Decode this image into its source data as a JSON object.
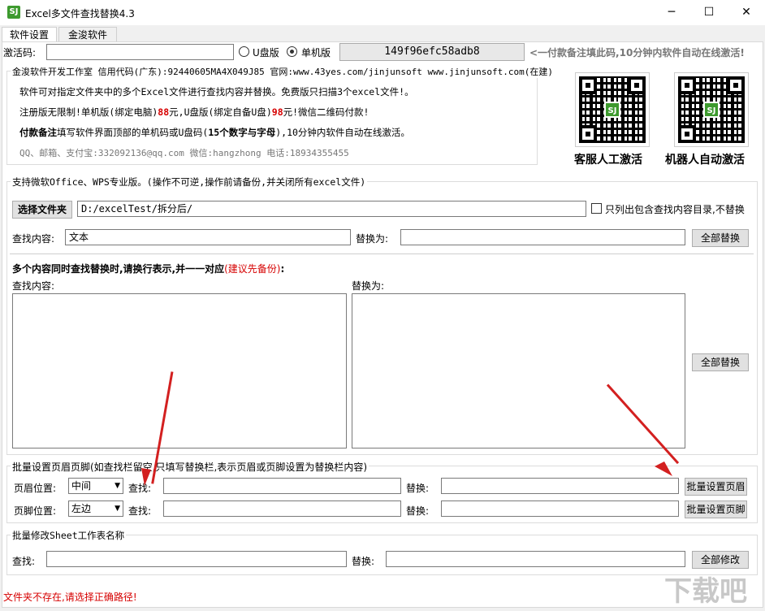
{
  "window": {
    "title": "Excel多文件查找替换4.3",
    "app_icon_text": "SJ"
  },
  "tabs": [
    {
      "label": "软件设置"
    },
    {
      "label": "金浚软件"
    }
  ],
  "activation": {
    "label": "激活码:",
    "value": "",
    "usb_label": "U盘版",
    "standalone_label": "单机版",
    "selected": "单机版",
    "machine_code": "149f96efc58adb8",
    "hint": "<一付款备注填此码,10分钟内软件自动在线激活!"
  },
  "info": {
    "header": "金浚软件开发工作室 信用代码(广东):92440605MA4X049J85 官网:www.43yes.com/jinjunsoft  www.jinjunsoft.com(在建)",
    "line1": "软件可对指定文件夹中的多个Excel文件进行查找内容并替换。免费版只扫描3个excel文件!。",
    "line2_a": "注册版无限制!单机版(绑定电脑)",
    "line2_b": "88",
    "line2_c": "元,U盘版(绑定自备U盘)",
    "line2_d": "98",
    "line2_e": "元!微信二维码付款!",
    "line3_a": "付款备注",
    "line3_b": "填写软件界面顶部的单机码或U盘码(",
    "line3_c": "15个数字与字母",
    "line3_d": "),10分钟内软件自动在线激活。",
    "contact": "QQ、邮箱、支付宝:332092136@qq.com  微信:hangzhong  电话:18934355455",
    "qr1_caption": "客服人工激活",
    "qr2_caption": "机器人自动激活",
    "qr_logo": "SJ"
  },
  "main": {
    "group_title": "支持微软Office、WPS专业版。(操作不可逆,操作前请备份,并关闭所有excel文件)",
    "choose_folder_button": "选择文件夹",
    "folder_path": "D:/excelTest/拆分后/",
    "only_list_label": "只列出包含查找内容目录,不替换",
    "find_label": "查找内容:",
    "find_value": "文本",
    "replace_label": "替换为:",
    "replace_value": "",
    "replace_all_button": "全部替换",
    "multi_title_a": "多个内容同时查找替换时,请换行表示,并一一对应",
    "multi_title_b": "(建议先备份)",
    "multi_title_c": ":",
    "multi_find_label": "查找内容:",
    "multi_replace_label": "替换为:",
    "multi_replace_all_button": "全部替换"
  },
  "header_footer": {
    "group_title": "批量设置页眉页脚(如查找栏留空,只填写替换栏,表示页眉或页脚设置为替换栏内容)",
    "header_pos_label": "页眉位置:",
    "header_pos_value": "中间",
    "footer_pos_label": "页脚位置:",
    "footer_pos_value": "左边",
    "find_label": "查找:",
    "replace_label": "替换:",
    "set_header_button": "批量设置页眉",
    "set_footer_button": "批量设置页脚"
  },
  "sheet": {
    "group_title": "批量修改Sheet工作表名称",
    "find_label": "查找:",
    "replace_label": "替换:",
    "modify_all_button": "全部修改"
  },
  "status": {
    "message": "文件夹不存在,请选择正确路径!"
  },
  "watermark": {
    "text": "下载吧"
  },
  "colors": {
    "accent_red": "#d60000",
    "arrow_red": "#d32020"
  }
}
